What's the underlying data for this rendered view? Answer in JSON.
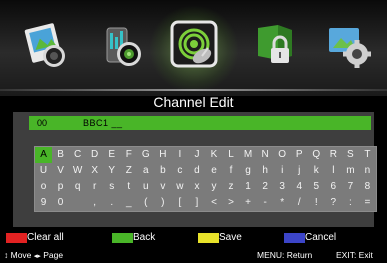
{
  "menu": {
    "icons": [
      {
        "name": "picture-icon"
      },
      {
        "name": "sound-icon"
      },
      {
        "name": "channel-icon"
      },
      {
        "name": "lock-icon"
      },
      {
        "name": "setup-icon"
      }
    ],
    "selected_index": 2
  },
  "page_title": "Channel Edit",
  "edit": {
    "channel_number": "00",
    "channel_name": "BBC1 __"
  },
  "keyboard": {
    "rows": [
      [
        "A",
        "B",
        "C",
        "D",
        "E",
        "F",
        "G",
        "H",
        "I",
        "J",
        "K",
        "L",
        "M",
        "N",
        "O",
        "P",
        "Q",
        "R",
        "S",
        "T"
      ],
      [
        "U",
        "V",
        "W",
        "X",
        "Y",
        "Z",
        "a",
        "b",
        "c",
        "d",
        "e",
        "f",
        "g",
        "h",
        "i",
        "j",
        "k",
        "l",
        "m",
        "n"
      ],
      [
        "o",
        "p",
        "q",
        "r",
        "s",
        "t",
        "u",
        "v",
        "w",
        "x",
        "y",
        "z",
        "1",
        "2",
        "3",
        "4",
        "5",
        "6",
        "7",
        "8"
      ],
      [
        "9",
        "0",
        " ",
        ",",
        ".",
        "_",
        "(",
        ")",
        "[",
        "]",
        "<",
        ">",
        "+",
        "-",
        "*",
        "/",
        "!",
        "?",
        ":",
        "="
      ]
    ],
    "selected_key": "A"
  },
  "legend": {
    "red": {
      "label": "Clear all",
      "color": "#e22222"
    },
    "green": {
      "label": "Back",
      "color": "#49b528"
    },
    "yellow": {
      "label": "Save",
      "color": "#e8e22a"
    },
    "blue": {
      "label": "Cancel",
      "color": "#3c45c8"
    }
  },
  "hints": {
    "move_icon": "↕",
    "move": "Move",
    "page_icon": "◂▸",
    "page": "Page",
    "menu": "MENU: Return",
    "exit": "EXIT: Exit"
  }
}
